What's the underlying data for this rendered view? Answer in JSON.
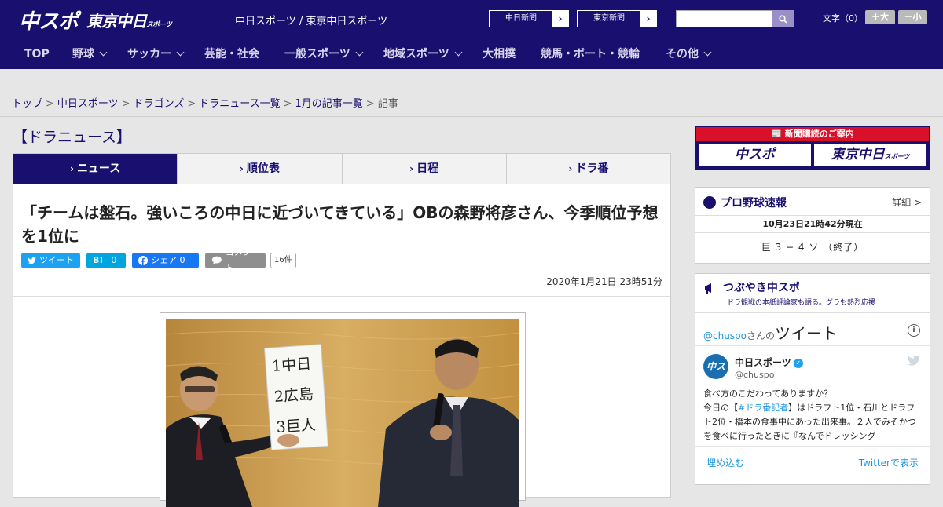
{
  "header": {
    "logo_chuspo": "中スポ",
    "logo_tokyo": "東京中日",
    "logo_tokyo_sub": "スポーツ",
    "site_title": "中日スポーツ / 東京中日スポーツ",
    "paper_links": [
      {
        "label": "中日新聞"
      },
      {
        "label": "東京新聞"
      }
    ],
    "search": {
      "value": "",
      "placeholder": ""
    },
    "font_size_label": "文字（0）",
    "font_larger": "＋大",
    "font_smaller": "－小"
  },
  "nav": {
    "items": [
      {
        "label": "TOP",
        "dropdown": false
      },
      {
        "label": "野球",
        "dropdown": true
      },
      {
        "label": "サッカー",
        "dropdown": true
      },
      {
        "label": "芸能・社会",
        "dropdown": false
      },
      {
        "label": "一般スポーツ",
        "dropdown": true
      },
      {
        "label": "地域スポーツ",
        "dropdown": true
      },
      {
        "label": "大相撲",
        "dropdown": false
      },
      {
        "label": "競馬・ボート・競輪",
        "dropdown": false
      },
      {
        "label": "その他",
        "dropdown": true
      }
    ]
  },
  "breadcrumb": {
    "items": [
      "トップ",
      "中日スポーツ",
      "ドラゴンズ",
      "ドラニュース一覧",
      "1月の記事一覧"
    ],
    "current": "記事",
    "separator": ">"
  },
  "main": {
    "section_title": "【ドラニュース】",
    "tabs": [
      {
        "label": "ニュース",
        "active": true
      },
      {
        "label": "順位表",
        "active": false
      },
      {
        "label": "日程",
        "active": false
      },
      {
        "label": "ドラ番",
        "active": false
      }
    ],
    "headline": "「チームは盤石。強いころの中日に近づいてきている」OBの森野将彦さん、今季順位予想を1位に",
    "share": {
      "tweet": "ツイート",
      "hatena_mark": "B!",
      "hatena_count": "0",
      "facebook": "シェア 0",
      "comment": "コメント",
      "comment_count": "16件"
    },
    "published": "2020年1月21日 23時51分",
    "photo": {
      "board_lines": [
        "1中日",
        "2広島",
        "3巨人"
      ]
    }
  },
  "sidebar": {
    "ad": {
      "title": "新聞購読のご案内",
      "logo_left": "中スポ",
      "logo_right": "東京中日",
      "logo_right_sub": "スポーツ"
    },
    "baseball": {
      "title": "プロ野球速報",
      "more": "詳細 >",
      "timestamp": "10月23日21時42分現在",
      "score": "巨 3 − 4 ソ （終了）"
    },
    "tsubuyaki": {
      "title": "つぶやき中スポ",
      "subtitle": "ドラ観戦の本紙評論家も語る。グラも熱烈応援",
      "embed_user": "@chuspo",
      "embed_user_suffix": "さんの",
      "embed_title": "ツイート",
      "tweet_name": "中日スポーツ",
      "tweet_handle": "@chuspo",
      "tweet_line1": "食べ方のこだわってありますか？",
      "tweet_line2_pre": "今日の【",
      "tweet_hashtag": "#ドラ番記者",
      "tweet_line2_post": "】はドラフト1位・石川とドラフト2位・橋本の食事中にあった出来事。２人でみそかつを食べに行ったときに『なんでドレッシング",
      "embed_link": "埋め込む",
      "view_link": "Twitterで表示"
    }
  },
  "colors": {
    "brand_navy": "#180f6e",
    "ad_red": "#d8102a",
    "twitter_blue": "#1da1f2",
    "facebook_blue": "#1877f2"
  }
}
